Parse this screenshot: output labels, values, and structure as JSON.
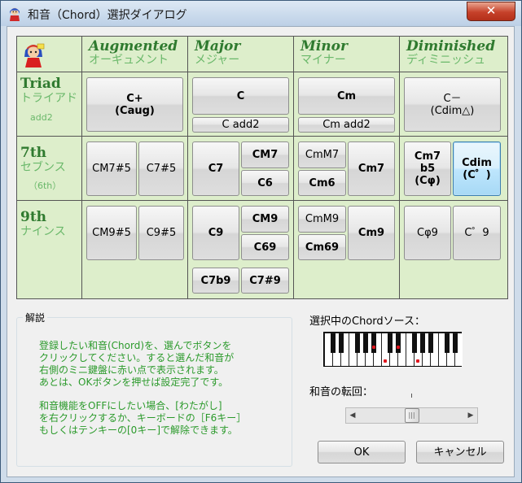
{
  "window": {
    "title": "和音（Chord）選択ダイアログ",
    "close_glyph": "✕"
  },
  "columns": [
    {
      "en": "Augmented",
      "ja": "オーギュメント"
    },
    {
      "en": "Major",
      "ja": "メジャー"
    },
    {
      "en": "Minor",
      "ja": "マイナー"
    },
    {
      "en": "Diminished",
      "ja": "ディミニッシュ"
    }
  ],
  "rows": {
    "triad": {
      "en": "Triad",
      "ja": "トライアド",
      "sub": "add2"
    },
    "seventh": {
      "en": "7th",
      "ja": "セブンス",
      "sub": "（6th）"
    },
    "ninth": {
      "en": "9th",
      "ja": "ナインス"
    }
  },
  "chords": {
    "aug_triad": "C+\n(Caug)",
    "maj_triad": "C",
    "maj_add2": "C add2",
    "min_triad": "Cm",
    "min_add2": "Cm add2",
    "dim_triad": "C－\n(Cdim△)",
    "aug_7_a": "CM7#5",
    "aug_7_b": "C7#5",
    "maj_7": "C7",
    "maj_m7": "CM7",
    "maj_6": "C6",
    "min_mm7": "CmM7",
    "min_m6": "Cm6",
    "min_m7": "Cm7",
    "dim_7_a": "Cm7\nb5\n(Cφ)",
    "dim_7_b": "Cdim\n(C゜)",
    "aug_9_a": "CM9#5",
    "aug_9_b": "C9#5",
    "maj_9": "C9",
    "maj_m9": "CM9",
    "maj_69": "C69",
    "maj_7b9": "C7b9",
    "maj_7s9": "C7#9",
    "min_mm9": "CmM9",
    "min_m69": "Cm69",
    "min_m9": "Cm9",
    "dim_9_a": "Cφ9",
    "dim_9_b": "C゜9"
  },
  "description": {
    "label": "解説",
    "lines": [
      "登録したい和音(Chord)を、選んでボタンを",
      "クリックしてください。すると選んだ和音が",
      "右側のミニ鍵盤に赤い点で表示されます。",
      "あとは、OKボタンを押せば設定完了です。",
      "和音機能をOFFにしたい場合、[わたがし]",
      "を右クリックするか、キーボードの［F6キー］",
      "もしくはテンキーの[0キー]で解除できます。"
    ]
  },
  "source_label": "選択中のChordソース：",
  "inversion_label": "和音の転回：",
  "inversion": {
    "position": 0.5
  },
  "piano": {
    "highlighted_white_keys": [
      7,
      11
    ],
    "highlighted_black_keys": [
      5,
      8
    ]
  },
  "buttons": {
    "ok": "OK",
    "cancel": "キャンセル"
  },
  "icons": {
    "app": "mascot-icon",
    "close": "close-icon",
    "thumb": "grip-icon"
  }
}
